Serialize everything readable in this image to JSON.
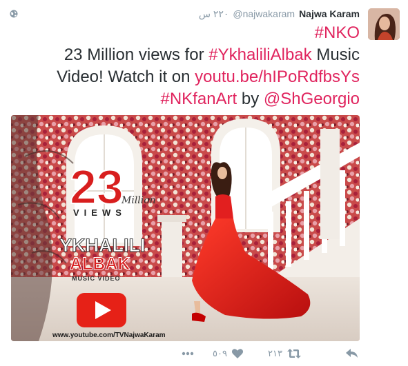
{
  "tweet": {
    "display_name": "Najwa Karam",
    "handle": "@najwakaram",
    "timestamp": "٢٢٠ س",
    "text": {
      "hashtag_line": "#NKO",
      "part1": "23 Million views for ",
      "hashtag_song": "#YkhaliliAlbak",
      "part2": " Music Video! Watch it on ",
      "url": "youtu.be/hIPoRdfbsYs",
      "hashtag_fanart": "#NKfanArt",
      "part3": " by ",
      "mention": "@ShGeorgio"
    },
    "media": {
      "big_number": "23",
      "million_label": "Million",
      "views_label": "VIEWS",
      "title_line1": "YKHALILI",
      "title_line2": "ALBAK",
      "subtitle": "MUSIC VIDEO",
      "channel_url": "www.youtube.com/TVNajwaKaram"
    },
    "actions": {
      "retweet_count": "٢١٣",
      "like_count": "٥٠٩"
    }
  },
  "colors": {
    "link": "#e0245e",
    "text": "#292f33",
    "muted": "#8899a6",
    "youtube_red": "#e62117"
  },
  "icons": [
    "globe-icon",
    "reply-icon",
    "retweet-icon",
    "like-icon",
    "more-icon",
    "play-icon"
  ]
}
